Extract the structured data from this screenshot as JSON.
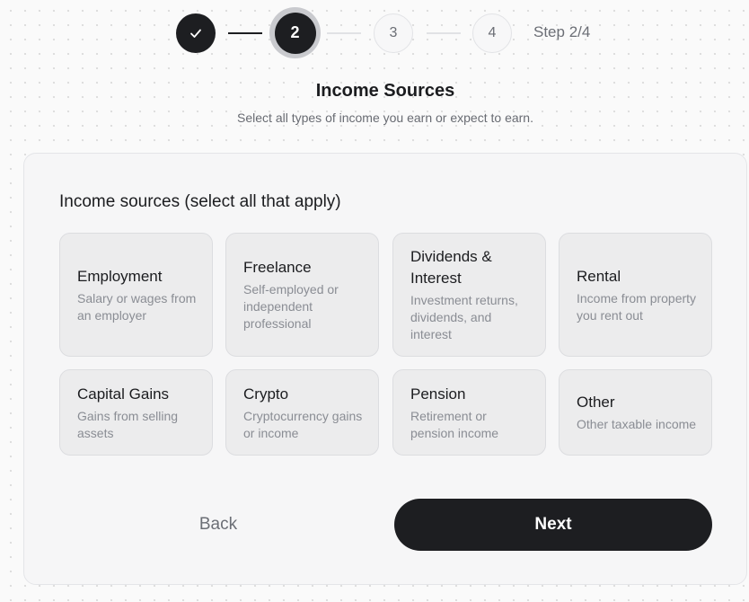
{
  "stepper": {
    "steps": [
      {
        "label": "",
        "state": "complete",
        "icon": "check-icon"
      },
      {
        "label": "2",
        "state": "current"
      },
      {
        "label": "3",
        "state": "upcoming"
      },
      {
        "label": "4",
        "state": "upcoming"
      }
    ],
    "counter": "Step 2/4"
  },
  "page": {
    "title": "Income Sources",
    "subtitle": "Select all types of income you earn or expect to earn."
  },
  "form": {
    "section_label": "Income sources (select all that apply)",
    "options": [
      {
        "title": "Employment",
        "description": "Salary or wages from an employer"
      },
      {
        "title": "Freelance",
        "description": "Self-employed or independent professional"
      },
      {
        "title": "Dividends & Interest",
        "description": "Investment returns, dividends, and interest"
      },
      {
        "title": "Rental",
        "description": "Income from property you rent out"
      },
      {
        "title": "Capital Gains",
        "description": "Gains from selling assets"
      },
      {
        "title": "Crypto",
        "description": "Cryptocurrency gains or income"
      },
      {
        "title": "Pension",
        "description": "Retirement or pension income"
      },
      {
        "title": "Other",
        "description": "Other taxable income"
      }
    ]
  },
  "actions": {
    "back_label": "Back",
    "next_label": "Next"
  },
  "colors": {
    "primary": "#1d1e21",
    "muted_text": "#8a8d94",
    "option_background": "#ececed"
  }
}
